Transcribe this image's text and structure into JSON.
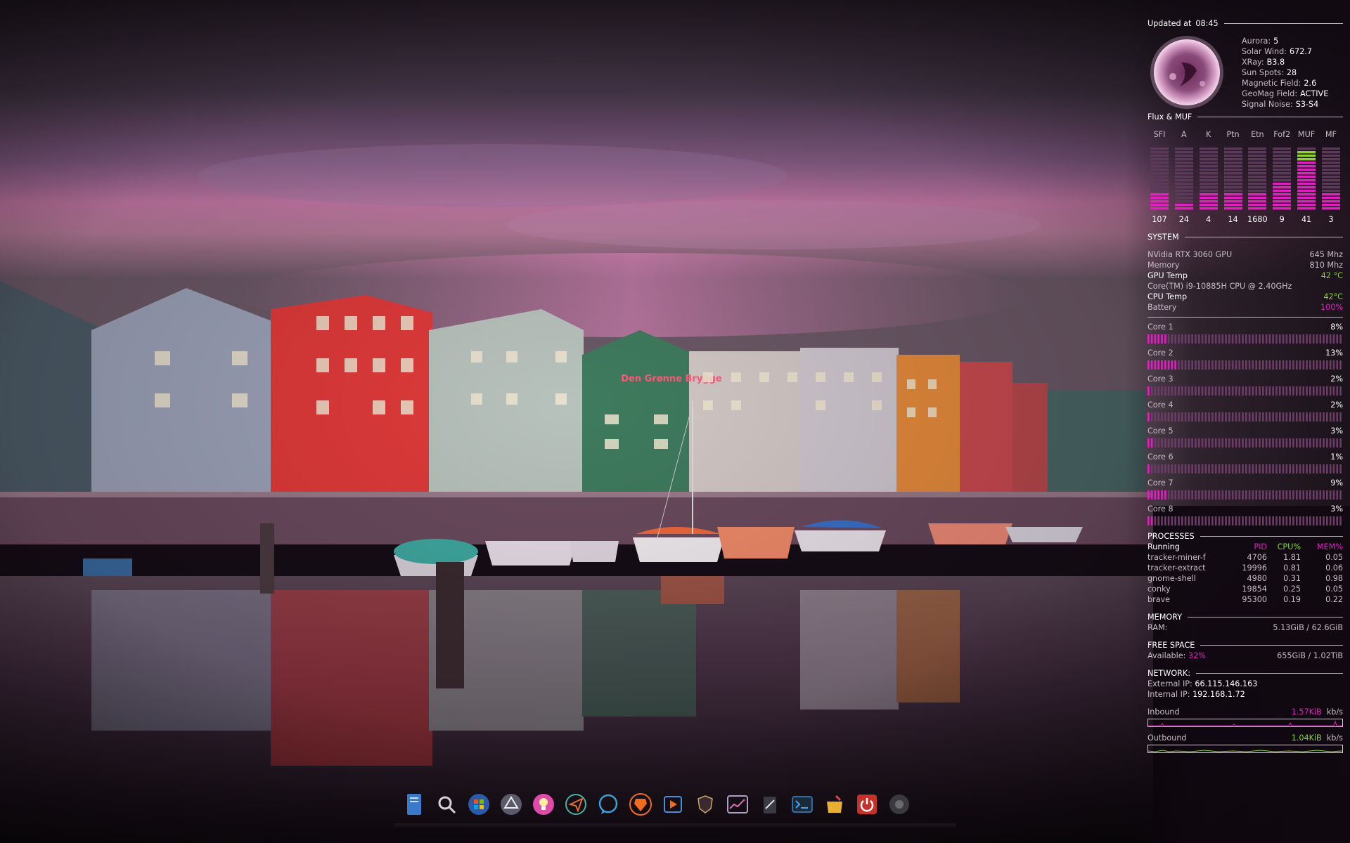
{
  "conky": {
    "updated_label": "Updated at",
    "updated_time": "08:45",
    "solar": [
      {
        "label": "Aurora:",
        "value": "5"
      },
      {
        "label": "Solar Wind:",
        "value": "672.7"
      },
      {
        "label": "XRay:",
        "value": "B3.8"
      },
      {
        "label": "Sun Spots:",
        "value": "28"
      },
      {
        "label": "Magnetic Field:",
        "value": "2.6"
      },
      {
        "label": "GeoMag Field:",
        "value": "ACTIVE"
      },
      {
        "label": "Signal Noise:",
        "value": "S3-S4"
      }
    ],
    "flux_header": "Flux & MUF",
    "flux": [
      {
        "label": "SFI",
        "value": "107",
        "level": 0.3
      },
      {
        "label": "A",
        "value": "24",
        "level": 0.12
      },
      {
        "label": "K",
        "value": "4",
        "level": 0.3
      },
      {
        "label": "Ptn",
        "value": "14",
        "level": 0.25
      },
      {
        "label": "Etn",
        "value": "1680",
        "level": 0.25
      },
      {
        "label": "Fof2",
        "value": "9",
        "level": 0.45
      },
      {
        "label": "MUF",
        "value": "41",
        "level": 0.95
      },
      {
        "label": "MF",
        "value": "3",
        "level": 0.3
      }
    ],
    "system_header": "SYSTEM",
    "gpu_name": "NVidia RTX 3060 GPU",
    "gpu_clock": "645 Mhz",
    "memory_label": "Memory",
    "memory_clock": "810 Mhz",
    "gpu_temp_label": "GPU Temp",
    "gpu_temp": "42 °C",
    "cpu_name": "Core(TM) i9-10885H CPU @ 2.40GHz",
    "cpu_temp_label": "CPU Temp",
    "cpu_temp": "42°C",
    "battery_label": "Battery",
    "battery": "100%",
    "cores": [
      {
        "label": "Core 1",
        "value": "8%",
        "fraction": 0.08
      },
      {
        "label": "Core 2",
        "value": "13%",
        "fraction": 0.13
      },
      {
        "label": "Core 3",
        "value": "2%",
        "fraction": 0.02
      },
      {
        "label": "Core 4",
        "value": "2%",
        "fraction": 0.02
      },
      {
        "label": "Core 5",
        "value": "3%",
        "fraction": 0.03
      },
      {
        "label": "Core 6",
        "value": "1%",
        "fraction": 0.01
      },
      {
        "label": "Core 7",
        "value": "9%",
        "fraction": 0.09
      },
      {
        "label": "Core 8",
        "value": "3%",
        "fraction": 0.03
      }
    ],
    "processes_header": "PROCESSES",
    "proc_columns": [
      "Running",
      "PID",
      "CPU%",
      "MEM%"
    ],
    "processes": [
      {
        "name": "tracker-miner-f",
        "pid": "4706",
        "cpu": "1.81",
        "mem": "0.05"
      },
      {
        "name": "tracker-extract",
        "pid": "19996",
        "cpu": "0.81",
        "mem": "0.06"
      },
      {
        "name": "gnome-shell",
        "pid": "4980",
        "cpu": "0.31",
        "mem": "0.98"
      },
      {
        "name": "conky",
        "pid": "19854",
        "cpu": "0.25",
        "mem": "0.05"
      },
      {
        "name": "brave",
        "pid": "95300",
        "cpu": "0.19",
        "mem": "0.22"
      }
    ],
    "memory_header": "MEMORY",
    "ram_label": "RAM:",
    "ram_value": "5.13GiB  /  62.6GiB",
    "free_header": "FREE SPACE",
    "available_label": "Available:",
    "available_pct": "32%",
    "disk_value": "655GiB  /  1.02TiB",
    "network_header": "NETWORK:",
    "external_label": "External IP:",
    "external_ip": "66.115.146.163",
    "internal_label": "Internal IP:",
    "internal_ip": "192.168.1.72",
    "inbound_label": "Inbound",
    "inbound_rate": "1.57KiB",
    "inbound_unit": "kb/s",
    "outbound_label": "Outbound",
    "outbound_rate": "1.04KiB",
    "outbound_unit": "kb/s"
  },
  "wallpaper": {
    "building_sign": "Den Grønne Brygge"
  },
  "dock": {
    "items": [
      "file-manager-icon",
      "scanner-icon",
      "windows-icon",
      "unity-icon",
      "lightbulb-icon",
      "send-icon",
      "chat-icon",
      "brave-icon",
      "media-player-icon",
      "shield-icon",
      "stocks-icon",
      "editor-icon",
      "terminal-icon",
      "archive-icon",
      "power-icon",
      "speaker-icon"
    ]
  },
  "colors": {
    "accent_pink": "#e020c0",
    "accent_green": "#8ad42c",
    "bar_dim": "#6a3c66"
  }
}
